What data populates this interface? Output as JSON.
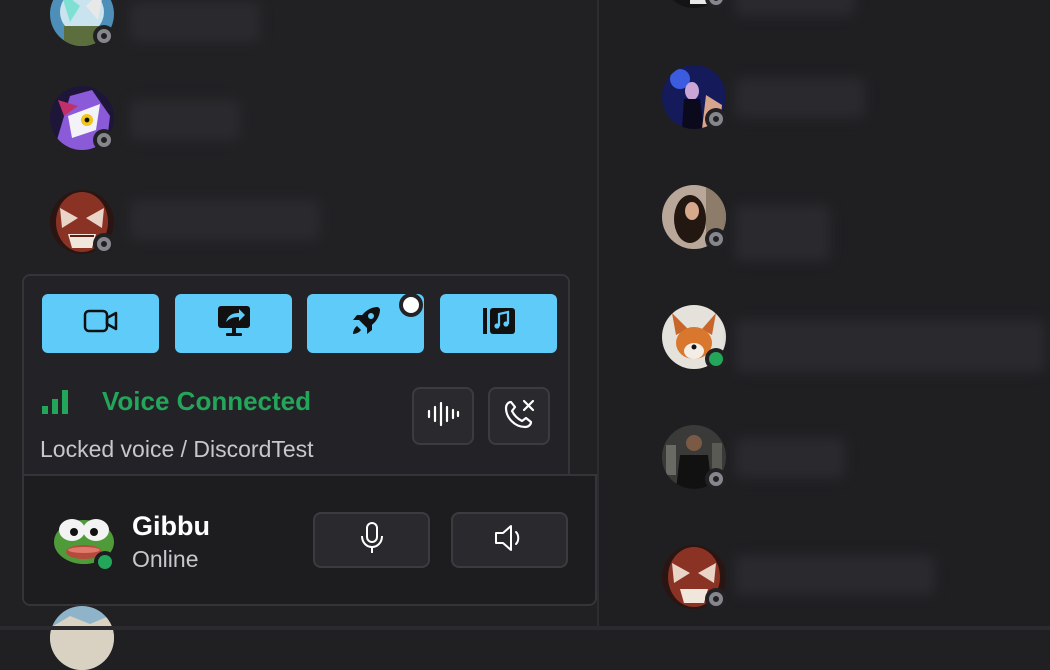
{
  "voice": {
    "status_label": "Voice Connected",
    "channel_label": "Locked voice / DiscordTest",
    "status_color": "#23a55a"
  },
  "activity_buttons": [
    {
      "icon": "camera-icon",
      "state": "inactive"
    },
    {
      "icon": "screen-share-icon",
      "state": "inactive"
    },
    {
      "icon": "rocket-icon",
      "state": "inactive"
    },
    {
      "icon": "music-library-icon",
      "state": "inactive"
    }
  ],
  "voice_actions": [
    {
      "icon": "soundwave-icon"
    },
    {
      "icon": "disconnect-call-icon"
    }
  ],
  "user": {
    "name": "Gibbu",
    "status": "Online",
    "avatar": "pepe-frog-avatar",
    "presence": "online"
  },
  "user_controls": [
    {
      "icon": "microphone-icon"
    },
    {
      "icon": "speaker-icon"
    }
  ],
  "members_left": [
    {
      "avatar": "anime-avatar",
      "presence": "offline"
    },
    {
      "avatar": "purple-anime-avatar",
      "presence": "offline"
    },
    {
      "avatar": "demon-avatar",
      "presence": "offline"
    },
    {
      "avatar": "landscape-avatar",
      "presence": "offline"
    }
  ],
  "members_right": [
    {
      "avatar": "dark-avatar",
      "presence": "offline"
    },
    {
      "avatar": "concert-avatar",
      "presence": "offline"
    },
    {
      "avatar": "portrait-avatar",
      "presence": "offline"
    },
    {
      "avatar": "fox-avatar",
      "presence": "online"
    },
    {
      "avatar": "group-avatar",
      "presence": "offline"
    },
    {
      "avatar": "demon-avatar",
      "presence": "offline"
    }
  ],
  "colors": {
    "accent": "#5fcbf8",
    "online": "#23a55a",
    "offline": "#86868d",
    "background": "#212124"
  }
}
